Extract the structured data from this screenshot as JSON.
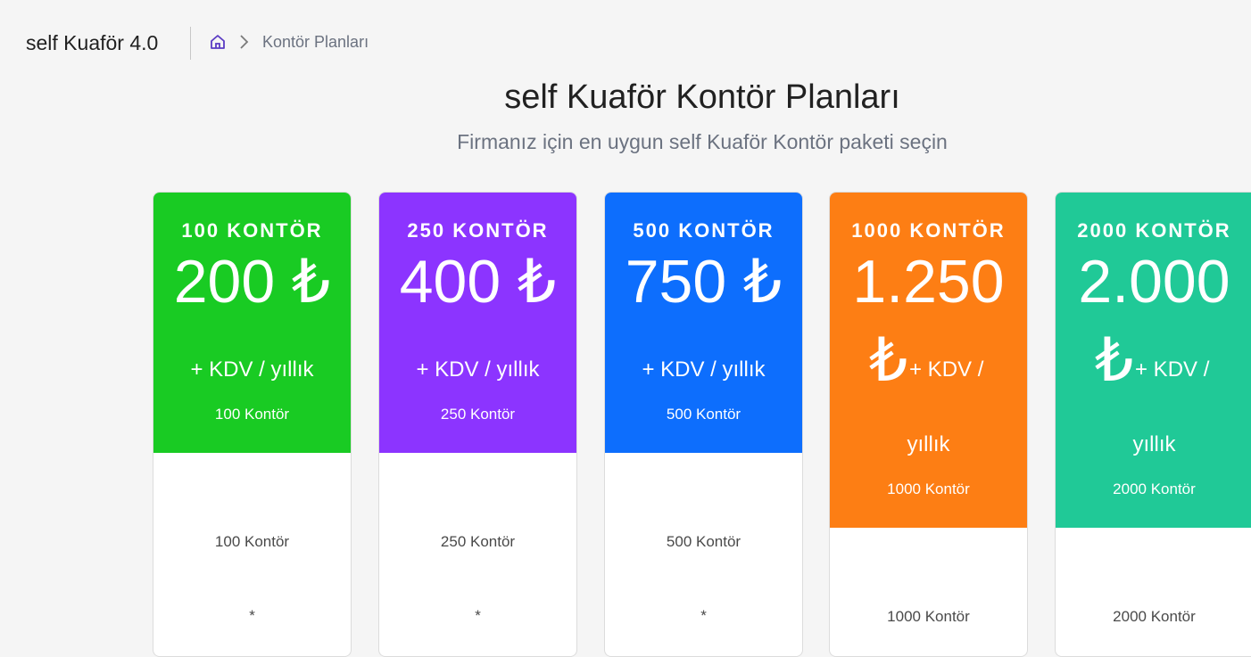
{
  "header": {
    "app_title": "self Kuaför 4.0",
    "breadcrumb": {
      "current": "Kontör Planları"
    }
  },
  "page": {
    "title": "self Kuaför Kontör Planları",
    "subtitle": "Firmanız için en uygun self Kuaför Kontör paketi seçin"
  },
  "plans": [
    {
      "name": "100 KONTÖR",
      "price": "200 ₺",
      "kdv": "+ KDV / yıllık",
      "count": "100 Kontör",
      "feature": "100 Kontör",
      "star": "*",
      "color": "#19cb23"
    },
    {
      "name": "250 KONTÖR",
      "price": "400 ₺",
      "kdv": "+ KDV / yıllık",
      "count": "250 Kontör",
      "feature": "250 Kontör",
      "star": "*",
      "color": "#8c34ff"
    },
    {
      "name": "500 KONTÖR",
      "price": "750 ₺",
      "kdv": "+ KDV / yıllık",
      "count": "500 Kontör",
      "feature": "500 Kontör",
      "star": "*",
      "color": "#0d6efd"
    },
    {
      "name": "1000 KONTÖR",
      "price": "1.250",
      "lira": "₺",
      "kdv_a": "+ KDV /",
      "kdv_b": "yıllık",
      "count": "1000 Kontör",
      "feature": "1000 Kontör",
      "color": "#fd7e14"
    },
    {
      "name": "2000 KONTÖR",
      "price": "2.000",
      "lira": "₺",
      "kdv_a": "+ KDV /",
      "kdv_b": "yıllık",
      "count": "2000 Kontör",
      "feature": "2000 Kontör",
      "color": "#20c997"
    }
  ],
  "icons": {
    "home": "home-icon",
    "chevron": "chevron-right-icon"
  },
  "colors": {
    "breadcrumb_home": "#5b3cc4"
  }
}
